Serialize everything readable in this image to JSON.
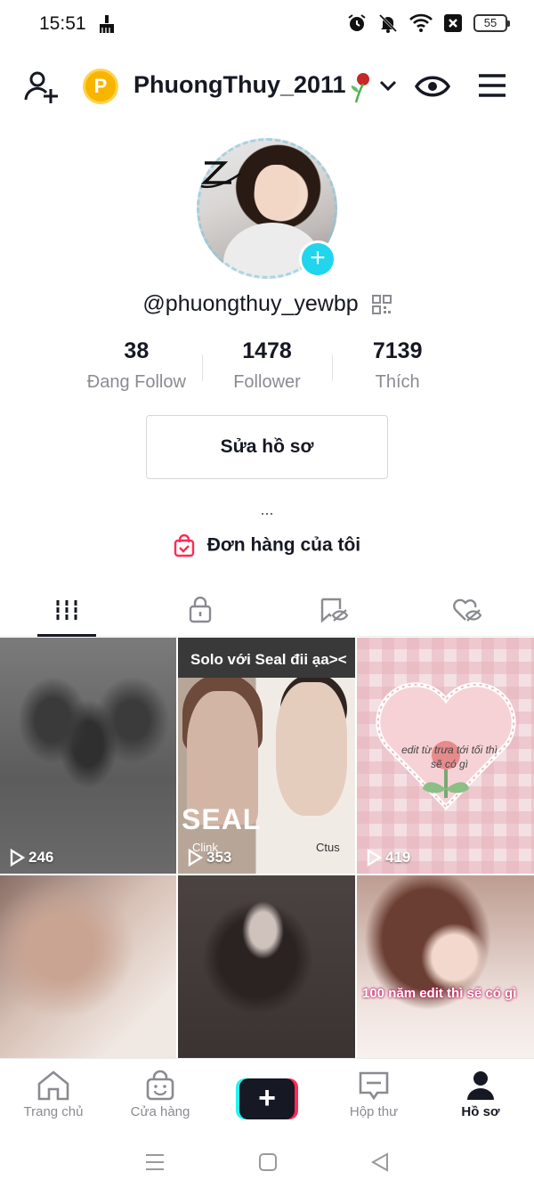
{
  "status_bar": {
    "time": "15:51",
    "battery": "55"
  },
  "header": {
    "coin_letter": "P",
    "username": "PhuongThuy_2011"
  },
  "profile": {
    "handle": "@phuongthuy_yewbp",
    "stats": [
      {
        "value": "38",
        "label": "Đang Follow"
      },
      {
        "value": "1478",
        "label": "Follower"
      },
      {
        "value": "7139",
        "label": "Thích"
      }
    ],
    "edit_label": "Sửa hồ sơ",
    "more": "...",
    "orders_label": "Đơn hàng của tôi"
  },
  "videos": [
    {
      "views": "246"
    },
    {
      "views": "353",
      "caption": "Solo với Seal đii ạa><",
      "overlay": "SEAL",
      "sub_left": "Clink",
      "sub_right": "Ctus"
    },
    {
      "views": "419",
      "overlay": "edit từ trưa tới tối thì sẽ có gì"
    },
    {
      "views": ""
    },
    {
      "views": ""
    },
    {
      "views": "",
      "overlay": "100 năm edit thì sẽ có gì"
    }
  ],
  "bottom_nav": [
    {
      "label": "Trang chủ",
      "icon": "home-icon"
    },
    {
      "label": "Cửa hàng",
      "icon": "shop-icon"
    },
    {
      "label": "",
      "icon": "create-icon"
    },
    {
      "label": "Hộp thư",
      "icon": "inbox-icon"
    },
    {
      "label": "Hồ sơ",
      "icon": "profile-icon",
      "active": true
    }
  ],
  "colors": {
    "accent_cyan": "#25f4ee",
    "accent_red": "#fe2c55",
    "badge_cyan": "#20d5ec",
    "coin": "#f7b500"
  }
}
